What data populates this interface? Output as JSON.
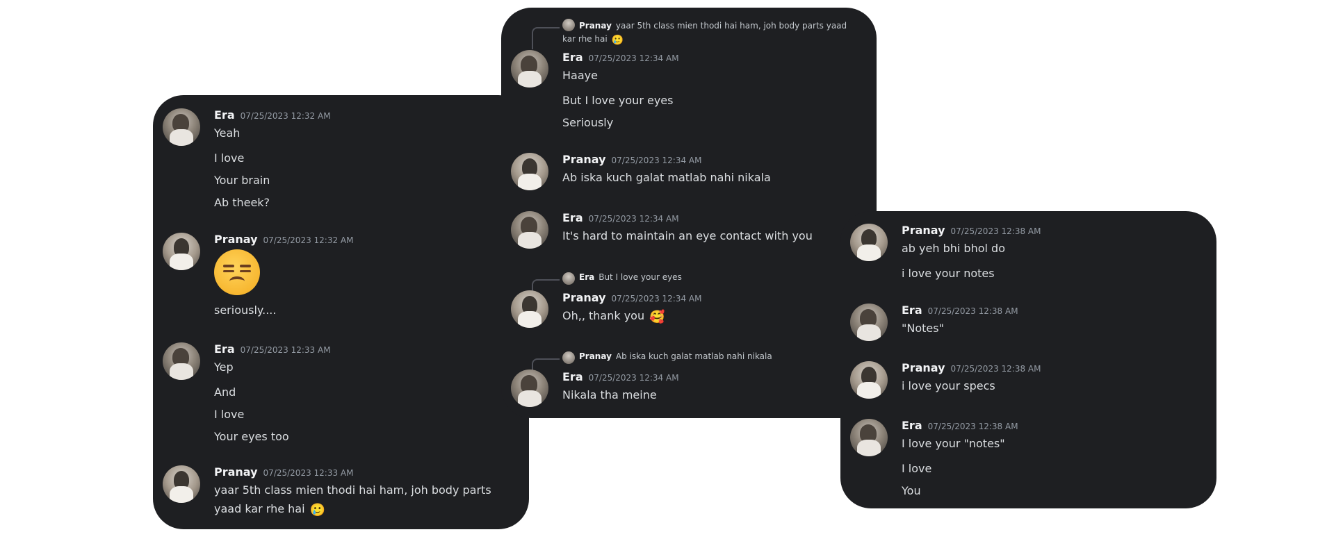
{
  "left": {
    "m1": {
      "name": "Era",
      "time": "07/25/2023 12:32 AM",
      "lines": [
        "Yeah",
        "I love",
        "Your brain",
        "Ab theek?"
      ]
    },
    "m2": {
      "name": "Pranay",
      "time": "07/25/2023 12:32 AM",
      "emoji": "unamused-face",
      "lines": [
        "seriously...."
      ]
    },
    "m3": {
      "name": "Era",
      "time": "07/25/2023 12:33 AM",
      "lines": [
        "Yep",
        "And",
        "I love",
        "Your eyes too"
      ]
    },
    "m4": {
      "name": "Pranay",
      "time": "07/25/2023 12:33 AM",
      "text": "yaar 5th class mien thodi hai ham, joh body parts yaad kar rhe hai",
      "emoji": "🥲"
    }
  },
  "middle": {
    "reply1": {
      "name": "Pranay",
      "text": "yaar 5th class mien thodi hai ham, joh body parts yaad kar rhe hai",
      "emoji": "🥲"
    },
    "m1": {
      "name": "Era",
      "time": "07/25/2023 12:34 AM",
      "lines": [
        "Haaye",
        "But I love your eyes",
        "Seriously"
      ]
    },
    "m2": {
      "name": "Pranay",
      "time": "07/25/2023 12:34 AM",
      "lines": [
        "Ab iska kuch galat matlab nahi nikala"
      ]
    },
    "m3": {
      "name": "Era",
      "time": "07/25/2023 12:34 AM",
      "lines": [
        "It's hard to maintain an eye contact with you"
      ]
    },
    "reply2": {
      "name": "Era",
      "text": "But I love your eyes"
    },
    "m4": {
      "name": "Pranay",
      "time": "07/25/2023 12:34 AM",
      "text": "Oh,, thank you",
      "emoji": "🥰"
    },
    "reply3": {
      "name": "Pranay",
      "text": "Ab iska kuch galat matlab nahi nikala"
    },
    "m5": {
      "name": "Era",
      "time": "07/25/2023 12:34 AM",
      "lines": [
        "Nikala tha meine"
      ]
    }
  },
  "right": {
    "m1": {
      "name": "Pranay",
      "time": "07/25/2023 12:38 AM",
      "lines": [
        "ab yeh bhi bhol do",
        "i love your notes"
      ]
    },
    "m2": {
      "name": "Era",
      "time": "07/25/2023 12:38 AM",
      "lines": [
        "\"Notes\""
      ]
    },
    "m3": {
      "name": "Pranay",
      "time": "07/25/2023 12:38 AM",
      "lines": [
        "i love your specs"
      ]
    },
    "m4": {
      "name": "Era",
      "time": "07/25/2023 12:38 AM",
      "lines": [
        "I love your \"notes\"",
        "I love",
        "You"
      ]
    }
  }
}
